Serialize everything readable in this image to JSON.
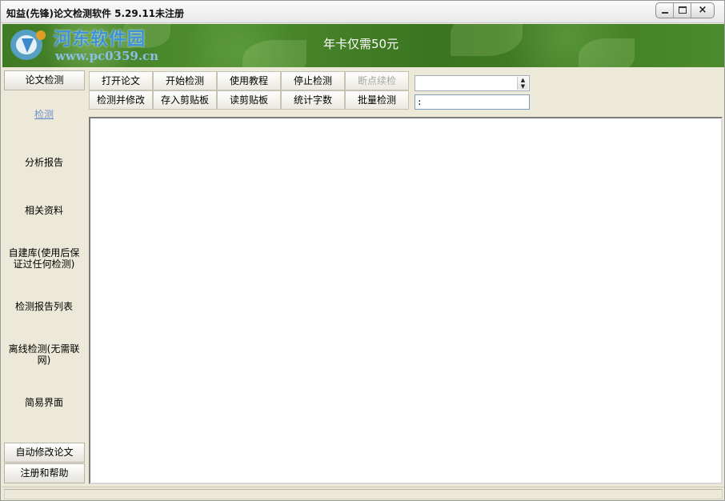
{
  "window": {
    "title": "知益(先锋)论文检测软件 5.29.11未注册",
    "controls": {
      "minimize": "minimize",
      "maximize": "maximize",
      "close": "×"
    }
  },
  "banner": {
    "watermark_name": "河东软件园",
    "watermark_url": "www.pc0359.cn",
    "promo": "年卡仅需50元",
    "logo_icon": "watermark-logo-icon",
    "colors": {
      "banner_green": "#4e8d2f",
      "watermark_blue": "#3b92d6",
      "promo_text": "#ffffff"
    }
  },
  "sidebar": {
    "top_tab": "论文检测",
    "items": [
      {
        "label": "检测",
        "active": true
      },
      {
        "label": "分析报告"
      },
      {
        "label": "相关资料"
      },
      {
        "label": "自建库(使用后保\n证过任何检测)"
      },
      {
        "label": "检测报告列表"
      },
      {
        "label": "离线检测(无需联\n网)"
      },
      {
        "label": "简易界面"
      }
    ],
    "bottom_tabs": [
      "自动修改论文",
      "注册和帮助"
    ],
    "colors": {
      "active_link": "#6f93c9"
    }
  },
  "toolbar": {
    "row1": [
      {
        "label": "打开论文"
      },
      {
        "label": "开始检测"
      },
      {
        "label": "使用教程"
      },
      {
        "label": "停止检测"
      },
      {
        "label": "断点续检",
        "disabled": true
      }
    ],
    "row2": [
      {
        "label": "检测并修改"
      },
      {
        "label": "存入剪贴板"
      },
      {
        "label": "读剪贴板"
      },
      {
        "label": "统计字数"
      },
      {
        "label": "批量检测"
      }
    ],
    "combo": {
      "value": "",
      "arrow_icon": "spinner-arrows-icon"
    },
    "text_field": {
      "value": ":"
    }
  },
  "editor": {
    "content": ""
  },
  "statusbar": {
    "text": ""
  }
}
